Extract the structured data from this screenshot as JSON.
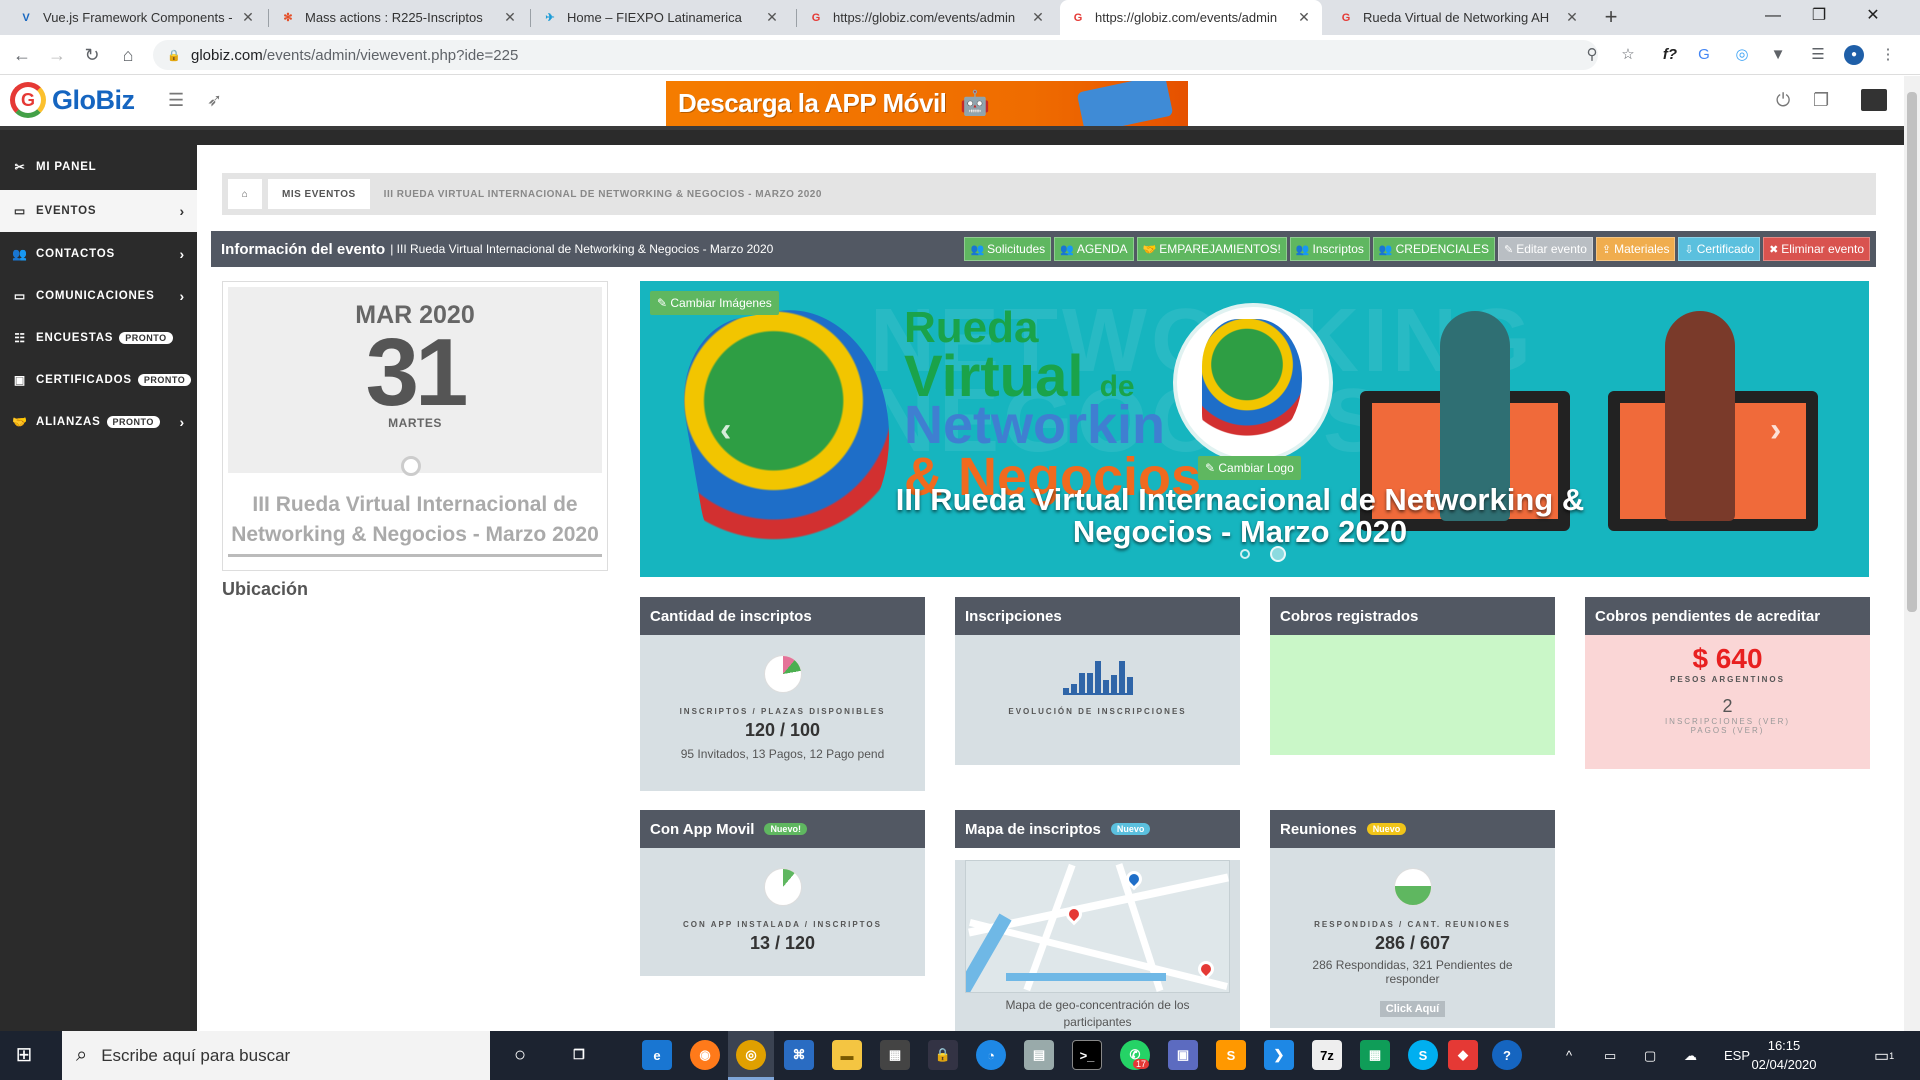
{
  "browser": {
    "tabs": [
      {
        "label": "Vue.js Framework Components -",
        "icon": "vuetify-icon",
        "color": "#1867c0"
      },
      {
        "label": "Mass actions : R225-Inscriptos",
        "icon": "joomla-icon",
        "color": "#e44d26"
      },
      {
        "label": "Home – FIEXPO Latinamerica",
        "icon": "fiexpo-icon",
        "color": "#1a9bd7"
      },
      {
        "label": "https://globiz.com/events/admin",
        "icon": "globiz-icon",
        "color": "#e53935"
      },
      {
        "label": "https://globiz.com/events/admin",
        "icon": "globiz-icon",
        "color": "#e53935"
      },
      {
        "label": "Rueda Virtual de Networking AH",
        "icon": "globiz-icon",
        "color": "#e53935"
      }
    ],
    "active_tab": 4,
    "url_host": "globiz.com",
    "url_path": "/events/admin/viewevent.php?ide=225"
  },
  "header": {
    "logo_text": "GloBiz",
    "logo_letter": "G",
    "banner_text": "Descarga la APP Móvil"
  },
  "sidebar": {
    "items": [
      {
        "label": "MI PANEL",
        "icon": "tools-icon",
        "badge": "",
        "chevron": false
      },
      {
        "label": "EVENTOS",
        "icon": "ticket-icon",
        "badge": "",
        "chevron": true
      },
      {
        "label": "CONTACTOS",
        "icon": "users-icon",
        "badge": "",
        "chevron": true
      },
      {
        "label": "COMUNICACIONES",
        "icon": "comments-icon",
        "badge": "",
        "chevron": true
      },
      {
        "label": "ENCUESTAS",
        "icon": "list-icon",
        "badge": "PRONTO",
        "chevron": false
      },
      {
        "label": "CERTIFICADOS",
        "icon": "briefcase-icon",
        "badge": "PRONTO",
        "chevron": false
      },
      {
        "label": "ALIANZAS",
        "icon": "handshake-icon",
        "badge": "PRONTO",
        "chevron": true
      }
    ],
    "active_index": 1
  },
  "breadcrumb": {
    "home_icon": "home-icon",
    "section": "MIS EVENTOS",
    "current": "III RUEDA VIRTUAL INTERNACIONAL DE NETWORKING & NEGOCIOS - MARZO 2020"
  },
  "infobar": {
    "title": "Información del evento",
    "subtitle": "| III Rueda Virtual Internacional de Networking & Negocios - Marzo 2020",
    "buttons": [
      {
        "label": "Solicitudes",
        "color": "#5fb760",
        "icon": "users-icon",
        "glyph": "👥"
      },
      {
        "label": "AGENDA",
        "color": "#5fb760",
        "icon": "users-icon",
        "glyph": "👥"
      },
      {
        "label": "EMPAREJAMIENTOS!",
        "color": "#5fb760",
        "icon": "handshake-icon",
        "glyph": "🤝"
      },
      {
        "label": "Inscriptos",
        "color": "#5fb760",
        "icon": "users-icon",
        "glyph": "👥"
      },
      {
        "label": "CREDENCIALES",
        "color": "#5fb760",
        "icon": "users-icon",
        "glyph": "👥"
      },
      {
        "label": "Editar evento",
        "color": "#b9bec3",
        "icon": "edit-icon",
        "glyph": "✎"
      },
      {
        "label": "Materiales",
        "color": "#f0ad4e",
        "icon": "upload-icon",
        "glyph": "⇪"
      },
      {
        "label": "Certificado",
        "color": "#5bc0de",
        "icon": "download-icon",
        "glyph": "⇩"
      },
      {
        "label": "Eliminar evento",
        "color": "#d9534f",
        "icon": "times-icon",
        "glyph": "✖"
      }
    ]
  },
  "date_card": {
    "month_year": "MAR 2020",
    "day": "31",
    "weekday": "MARTES",
    "event_name": "III Rueda Virtual Internacional de Networking & Negocios - Marzo 2020"
  },
  "location_heading": "Ubicación",
  "hero": {
    "change_images": "Cambiar Imágenes",
    "change_logo": "Cambiar Logo",
    "title_rueda": "Rueda",
    "title_virtual": "Virtual",
    "title_de": "de",
    "title_networking": "Networkin",
    "title_negocios": "& Negocios",
    "caption": "III Rueda Virtual Internacional de Networking & Negocios - Marzo 2020",
    "slide_count": 2,
    "active_slide": 1
  },
  "cards": {
    "inscriptos": {
      "title": "Cantidad de inscriptos",
      "label": "INSCRIPTOS / PLAZAS DISPONIBLES",
      "value": "120 / 100",
      "note": "95 Invitados, 13 Pagos, 12 Pago pend",
      "pie_fraction": 0.22,
      "pie_colors": [
        "#4caf50",
        "#e91e63"
      ]
    },
    "inscripciones": {
      "title": "Inscripciones",
      "label": "EVOLUCIÓN DE INSCRIPCIONES",
      "bar_levels": [
        0.15,
        0.25,
        0.55,
        0.55,
        0.9,
        0.35,
        0.5,
        0.9,
        0.45
      ]
    },
    "cobros": {
      "title": "Cobros registrados"
    },
    "pendientes": {
      "title": "Cobros pendientes de acreditar",
      "amount": "$ 640",
      "currency": "PESOS ARGENTINOS",
      "count": "2",
      "line1": "INSCRIPCIONES (VER)",
      "line2": "PAGOS (VER)"
    },
    "app": {
      "title": "Con App Movil",
      "badge": "Nuevo!",
      "label": "CON APP INSTALADA / INSCRIPTOS",
      "value": "13 / 120",
      "pie_fraction": 0.11
    },
    "mapa": {
      "title": "Mapa de inscriptos",
      "badge": "Nuevo",
      "caption": "Mapa de geo-concentración de los participantes"
    },
    "reuniones": {
      "title": "Reuniones",
      "badge": "Nuevo",
      "label": "RESPONDIDAS / CANT. REUNIONES",
      "value": "286 / 607",
      "note": "286 Respondidas, 321 Pendientes de responder",
      "cta": "Click Aquí",
      "pie_fraction": 0.47
    }
  },
  "colors": {
    "accent_green": "#5fb760",
    "hero_teal": "#16b5bf",
    "sidebar_dark": "#2b2b2b",
    "card_header": "#525863",
    "pending_red": "#e82020"
  },
  "taskbar": {
    "search_placeholder": "Escribe aquí para buscar",
    "language": "ESP",
    "time": "16:15",
    "date": "02/04/2020",
    "whatsapp_badge": "17",
    "notification_count": "1"
  }
}
